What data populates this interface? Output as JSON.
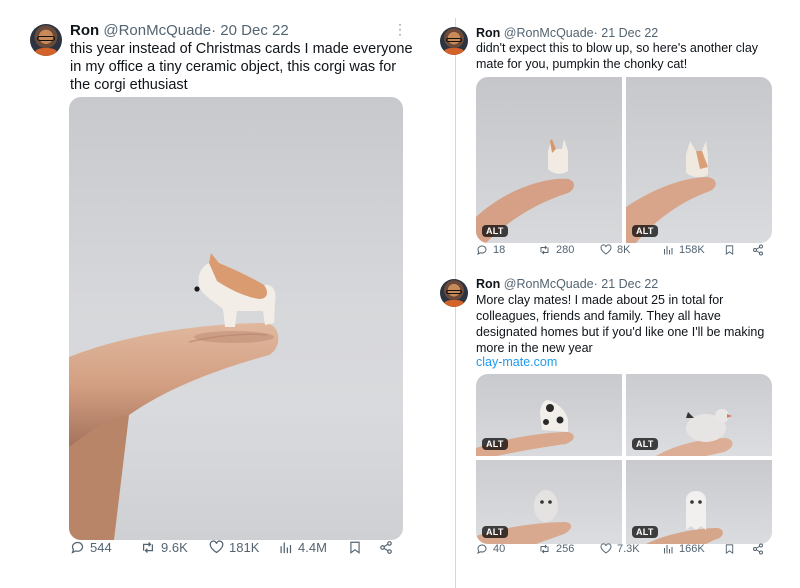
{
  "tweets": [
    {
      "name": "Ron",
      "handle": "@RonMcQuade",
      "date": "20 Dec 22",
      "lines": [
        "this year instead of Christmas cards I made everyone",
        "in my office a tiny ceramic object, this corgi was for",
        "the corgi ethusiast"
      ],
      "stats": {
        "replies": "544",
        "reposts": "9.6K",
        "likes": "181K",
        "views": "4.4M"
      }
    },
    {
      "name": "Ron",
      "handle": "@RonMcQuade",
      "date": "21 Dec 22",
      "lines": [
        "didn't expect this to blow up, so here's another clay",
        "mate for you, pumpkin the chonky cat!"
      ],
      "alt_badges": [
        "ALT",
        "ALT"
      ],
      "stats": {
        "replies": "18",
        "reposts": "280",
        "likes": "8K",
        "views": "158K"
      }
    },
    {
      "name": "Ron",
      "handle": "@RonMcQuade",
      "date": "21 Dec 22",
      "lines": [
        "More clay mates! I made about 25 in total for",
        "colleagues, friends and family. They all have",
        "designated homes but if you'd like one I'll be making",
        "more in the new year"
      ],
      "link": "clay-mate.com",
      "alt_badges": [
        "ALT",
        "ALT",
        "ALT",
        "ALT"
      ],
      "stats": {
        "replies": "40",
        "reposts": "256",
        "likes": "7.3K",
        "views": "166K"
      }
    }
  ],
  "separator": "·",
  "colors": {
    "text": "#0f1419",
    "secondary": "#536471",
    "link": "#1d9bf0",
    "divider": "#cfd9de"
  }
}
